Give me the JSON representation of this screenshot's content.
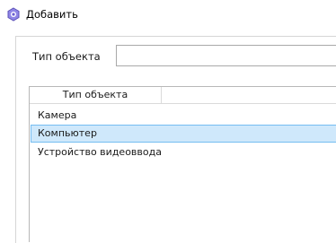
{
  "window": {
    "title": "Добавить",
    "icon": "app-icon"
  },
  "form": {
    "type_label": "Тип объекта",
    "type_value": ""
  },
  "list": {
    "column_header": "Тип объекта",
    "items": [
      {
        "label": "Камера",
        "selected": false
      },
      {
        "label": "Компьютер",
        "selected": true
      },
      {
        "label": "Устройство видеоввода",
        "selected": false
      }
    ]
  },
  "colors": {
    "selection_fill": "#cfe8fb",
    "selection_border": "#75bdf1",
    "icon_accent": "#7b6fd6"
  }
}
